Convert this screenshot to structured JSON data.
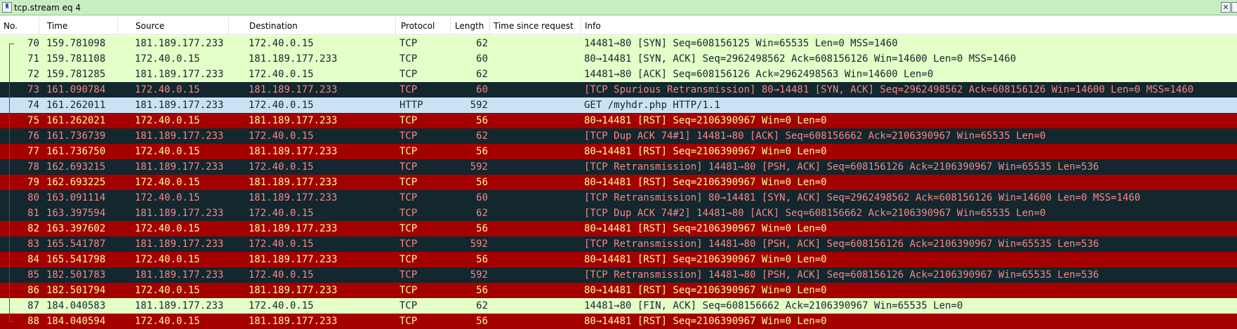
{
  "filter": {
    "text": "tcp.stream eq 4"
  },
  "columns": [
    "No.",
    "Time",
    "Source",
    "Destination",
    "Protocol",
    "Length",
    "Time since request",
    "Info"
  ],
  "styles": {
    "syn": {
      "bg": "#e4ffc7",
      "fg": "#12272e"
    },
    "http": {
      "bg": "#c9e3f5",
      "fg": "#12272e"
    },
    "bad": {
      "bg": "#12272e",
      "fg": "#f78787"
    },
    "rst": {
      "bg": "#a40000",
      "fg": "#fffc9c"
    }
  },
  "packets": [
    {
      "no": "70",
      "time": "159.781098",
      "src": "181.189.177.233",
      "dst": "172.40.0.15",
      "proto": "TCP",
      "len": "62",
      "tsr": "",
      "info": "14481→80 [SYN] Seq=608156125 Win=65535 Len=0 MSS=1460",
      "style": "syn"
    },
    {
      "no": "71",
      "time": "159.781108",
      "src": "172.40.0.15",
      "dst": "181.189.177.233",
      "proto": "TCP",
      "len": "60",
      "tsr": "",
      "info": "80→14481 [SYN, ACK] Seq=2962498562 Ack=608156126 Win=14600 Len=0 MSS=1460",
      "style": "syn"
    },
    {
      "no": "72",
      "time": "159.781285",
      "src": "181.189.177.233",
      "dst": "172.40.0.15",
      "proto": "TCP",
      "len": "62",
      "tsr": "",
      "info": "14481→80 [ACK] Seq=608156126 Ack=2962498563 Win=14600 Len=0",
      "style": "syn"
    },
    {
      "no": "73",
      "time": "161.090784",
      "src": "172.40.0.15",
      "dst": "181.189.177.233",
      "proto": "TCP",
      "len": "60",
      "tsr": "",
      "info": "[TCP Spurious Retransmission] 80→14481 [SYN, ACK] Seq=2962498562 Ack=608156126 Win=14600 Len=0 MSS=1460",
      "style": "bad"
    },
    {
      "no": "74",
      "time": "161.262011",
      "src": "181.189.177.233",
      "dst": "172.40.0.15",
      "proto": "HTTP",
      "len": "592",
      "tsr": "",
      "info": "GET /myhdr.php HTTP/1.1",
      "style": "http"
    },
    {
      "no": "75",
      "time": "161.262021",
      "src": "172.40.0.15",
      "dst": "181.189.177.233",
      "proto": "TCP",
      "len": "56",
      "tsr": "",
      "info": "80→14481 [RST] Seq=2106390967 Win=0 Len=0",
      "style": "rst"
    },
    {
      "no": "76",
      "time": "161.736739",
      "src": "181.189.177.233",
      "dst": "172.40.0.15",
      "proto": "TCP",
      "len": "62",
      "tsr": "",
      "info": "[TCP Dup ACK 74#1] 14481→80 [ACK] Seq=608156662 Ack=2106390967 Win=65535 Len=0",
      "style": "bad"
    },
    {
      "no": "77",
      "time": "161.736750",
      "src": "172.40.0.15",
      "dst": "181.189.177.233",
      "proto": "TCP",
      "len": "56",
      "tsr": "",
      "info": "80→14481 [RST] Seq=2106390967 Win=0 Len=0",
      "style": "rst"
    },
    {
      "no": "78",
      "time": "162.693215",
      "src": "181.189.177.233",
      "dst": "172.40.0.15",
      "proto": "TCP",
      "len": "592",
      "tsr": "",
      "info": "[TCP Retransmission] 14481→80 [PSH, ACK] Seq=608156126 Ack=2106390967 Win=65535 Len=536",
      "style": "bad"
    },
    {
      "no": "79",
      "time": "162.693225",
      "src": "172.40.0.15",
      "dst": "181.189.177.233",
      "proto": "TCP",
      "len": "56",
      "tsr": "",
      "info": "80→14481 [RST] Seq=2106390967 Win=0 Len=0",
      "style": "rst"
    },
    {
      "no": "80",
      "time": "163.091114",
      "src": "172.40.0.15",
      "dst": "181.189.177.233",
      "proto": "TCP",
      "len": "60",
      "tsr": "",
      "info": "[TCP Retransmission] 80→14481 [SYN, ACK] Seq=2962498562 Ack=608156126 Win=14600 Len=0 MSS=1460",
      "style": "bad"
    },
    {
      "no": "81",
      "time": "163.397594",
      "src": "181.189.177.233",
      "dst": "172.40.0.15",
      "proto": "TCP",
      "len": "62",
      "tsr": "",
      "info": "[TCP Dup ACK 74#2] 14481→80 [ACK] Seq=608156662 Ack=2106390967 Win=65535 Len=0",
      "style": "bad"
    },
    {
      "no": "82",
      "time": "163.397602",
      "src": "172.40.0.15",
      "dst": "181.189.177.233",
      "proto": "TCP",
      "len": "56",
      "tsr": "",
      "info": "80→14481 [RST] Seq=2106390967 Win=0 Len=0",
      "style": "rst"
    },
    {
      "no": "83",
      "time": "165.541787",
      "src": "181.189.177.233",
      "dst": "172.40.0.15",
      "proto": "TCP",
      "len": "592",
      "tsr": "",
      "info": "[TCP Retransmission] 14481→80 [PSH, ACK] Seq=608156126 Ack=2106390967 Win=65535 Len=536",
      "style": "bad"
    },
    {
      "no": "84",
      "time": "165.541798",
      "src": "172.40.0.15",
      "dst": "181.189.177.233",
      "proto": "TCP",
      "len": "56",
      "tsr": "",
      "info": "80→14481 [RST] Seq=2106390967 Win=0 Len=0",
      "style": "rst"
    },
    {
      "no": "85",
      "time": "182.501783",
      "src": "181.189.177.233",
      "dst": "172.40.0.15",
      "proto": "TCP",
      "len": "592",
      "tsr": "",
      "info": "[TCP Retransmission] 14481→80 [PSH, ACK] Seq=608156126 Ack=2106390967 Win=65535 Len=536",
      "style": "bad"
    },
    {
      "no": "86",
      "time": "182.501794",
      "src": "172.40.0.15",
      "dst": "181.189.177.233",
      "proto": "TCP",
      "len": "56",
      "tsr": "",
      "info": "80→14481 [RST] Seq=2106390967 Win=0 Len=0",
      "style": "rst"
    },
    {
      "no": "87",
      "time": "184.040583",
      "src": "181.189.177.233",
      "dst": "172.40.0.15",
      "proto": "TCP",
      "len": "62",
      "tsr": "",
      "info": "14481→80 [FIN, ACK] Seq=608156662 Ack=2106390967 Win=65535 Len=0",
      "style": "syn"
    },
    {
      "no": "88",
      "time": "184.040594",
      "src": "172.40.0.15",
      "dst": "181.189.177.233",
      "proto": "TCP",
      "len": "56",
      "tsr": "",
      "info": "80→14481 [RST] Seq=2106390967 Win=0 Len=0",
      "style": "rst"
    }
  ]
}
